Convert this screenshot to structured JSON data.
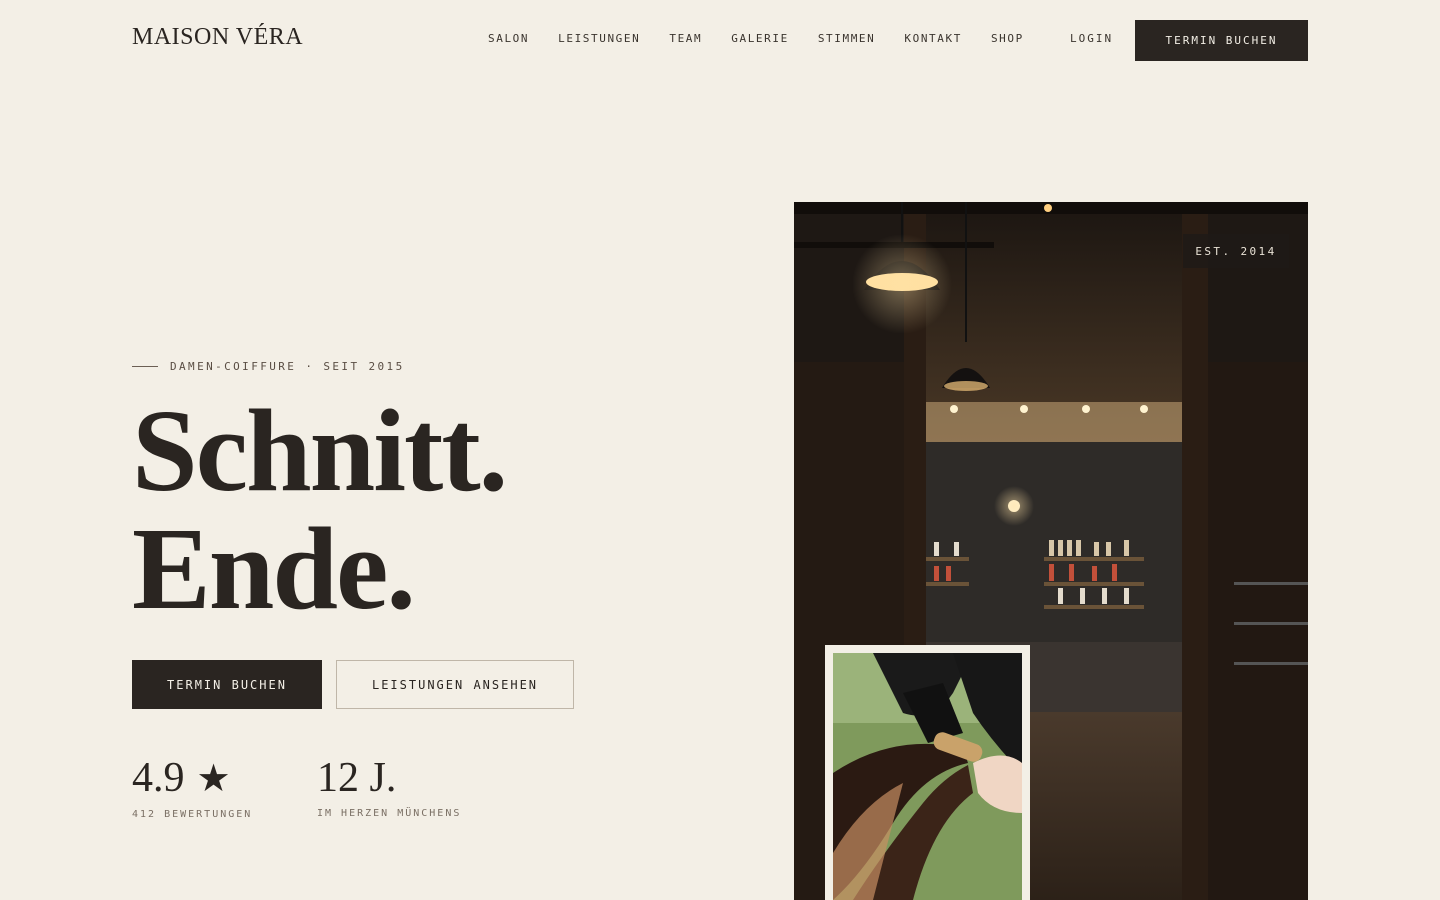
{
  "header": {
    "logo": "MAISON VÉRA",
    "nav": [
      "SALON",
      "LEISTUNGEN",
      "TEAM",
      "GALERIE",
      "STIMMEN",
      "KONTAKT",
      "SHOP"
    ],
    "login": "LOGIN",
    "cta": "TERMIN BUCHEN"
  },
  "hero": {
    "eyebrow": "DAMEN-COIFFURE · SEIT 2015",
    "headline_line1": "Schnitt.",
    "headline_line2": "Ende.",
    "primary_button": "TERMIN BUCHEN",
    "secondary_button": "LEISTUNGEN ANSEHEN",
    "stats": [
      {
        "value": "4.9",
        "label": "412 BEWERTUNGEN"
      },
      {
        "value": "12 J.",
        "label": "IM HERZEN MÜNCHENS"
      }
    ]
  },
  "media": {
    "badge": "EST. 2014",
    "main_image": "salon-interior-photo",
    "inset_image": "hair-drying-photo"
  },
  "colors": {
    "background": "#f3efe6",
    "ink": "#2a2521",
    "muted": "#7a6f64"
  }
}
